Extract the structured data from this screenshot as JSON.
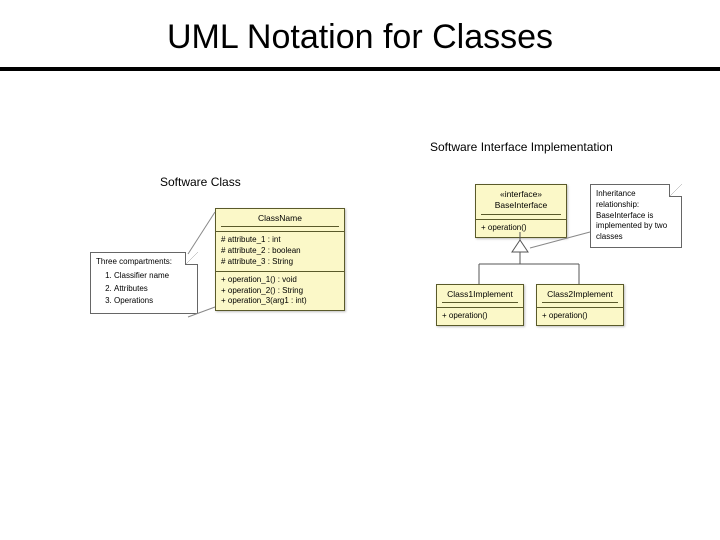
{
  "title": "UML Notation for Classes",
  "leftTitle": "Software Class",
  "rightTitle": "Software Interface Implementation",
  "noteLeft": {
    "heading": "Three compartments:",
    "items": [
      "Classifier name",
      "Attributes",
      "Operations"
    ]
  },
  "classBox": {
    "name": "ClassName",
    "attrs": [
      "#  attribute_1 : int",
      "#  attribute_2 : boolean",
      "#  attribute_3 : String"
    ],
    "ops": [
      "+  operation_1() : void",
      "+  operation_2() : String",
      "+  operation_3(arg1 : int)"
    ]
  },
  "interfaceBox": {
    "stereotype": "«interface»",
    "name": "BaseInterface",
    "ops": [
      "+  operation()"
    ]
  },
  "impl1": {
    "name": "Class1Implement",
    "ops": [
      "+  operation()"
    ]
  },
  "impl2": {
    "name": "Class2Implement",
    "ops": [
      "+  operation()"
    ]
  },
  "noteRight": {
    "text": "Inheritance relationship: BaseInterface is implemented by two classes"
  }
}
